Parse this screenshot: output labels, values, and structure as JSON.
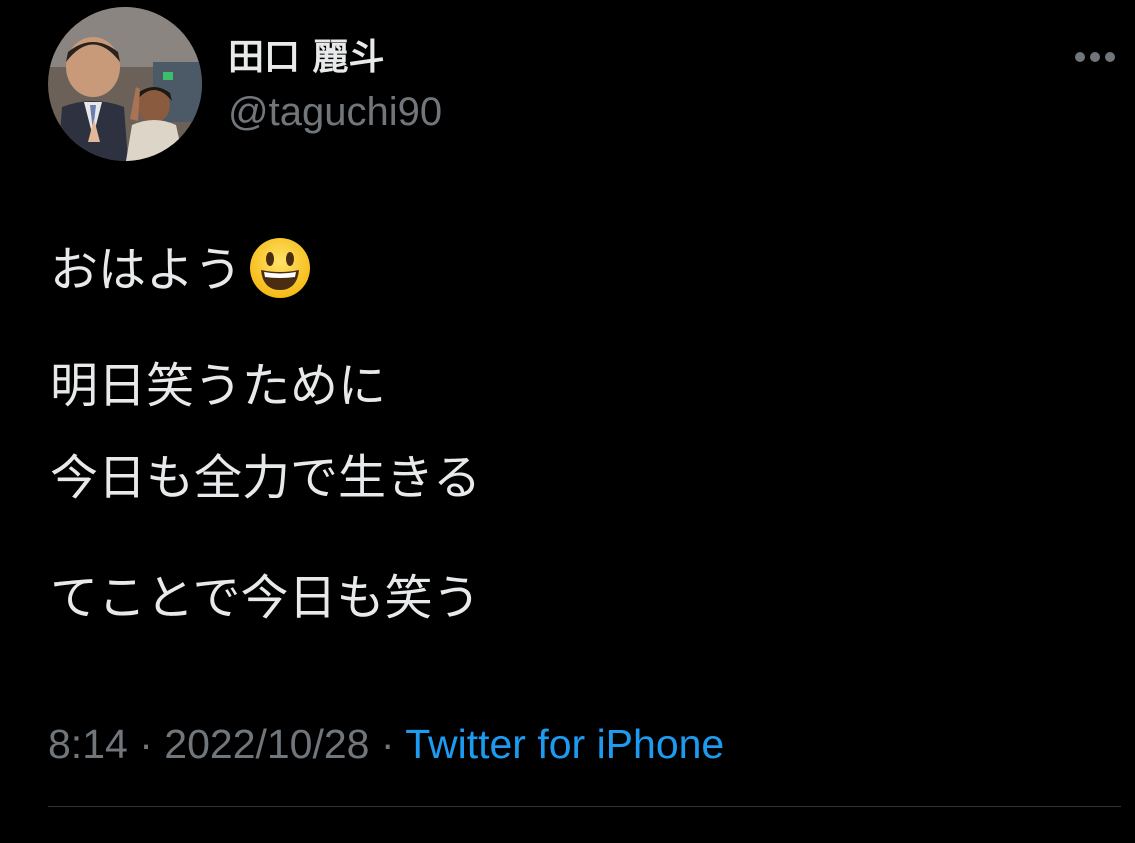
{
  "author": {
    "display_name": "田口 麗斗",
    "handle": "@taguchi90",
    "avatar_icon": "profile-photo"
  },
  "more_icon": "ellipsis-icon",
  "tweet": {
    "line1": "おはよう",
    "emoji": "grinning-face-emoji",
    "line2": "明日笑うために",
    "line3": "今日も全力で生きる",
    "line4": "てことで今日も笑う"
  },
  "meta": {
    "time": "8:14",
    "separator": "·",
    "date": "2022/10/28",
    "source": "Twitter for iPhone"
  },
  "colors": {
    "background": "#000000",
    "text": "#e7e9ea",
    "secondary": "#71767b",
    "link": "#1d9bf0",
    "divider": "#2f3336"
  }
}
